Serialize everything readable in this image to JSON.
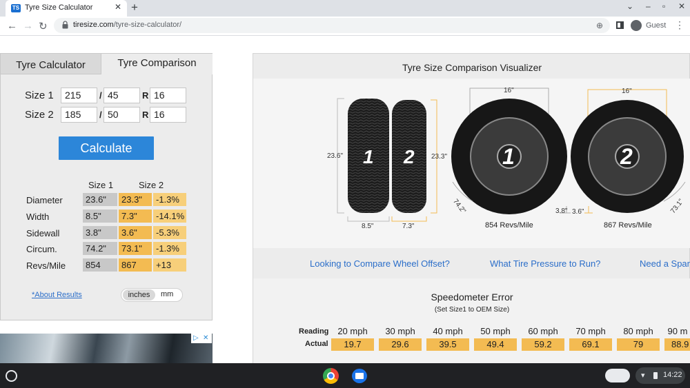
{
  "browser": {
    "tab_title": "Tyre Size Calculator",
    "favicon_text": "TS",
    "url_host": "tiresize.com",
    "url_path": "/tyre-size-calculator/",
    "profile_label": "Guest"
  },
  "calculator": {
    "tabs": [
      {
        "label": "Tyre Calculator"
      },
      {
        "label": "Tyre Comparison"
      }
    ],
    "size1": {
      "label": "Size 1",
      "width": "215",
      "aspect": "45",
      "rim": "16"
    },
    "size2": {
      "label": "Size 2",
      "width": "185",
      "aspect": "50",
      "rim": "16"
    },
    "slash": "/",
    "r": "R",
    "calculate_label": "Calculate",
    "col_headers": {
      "size1": "Size 1",
      "size2": "Size 2"
    },
    "rows": [
      {
        "label": "Diameter",
        "size1": "23.6\"",
        "size2": "23.3\"",
        "diff": "-1.3%"
      },
      {
        "label": "Width",
        "size1": "8.5\"",
        "size2": "7.3\"",
        "diff": "-14.1%"
      },
      {
        "label": "Sidewall",
        "size1": "3.8\"",
        "size2": "3.6\"",
        "diff": "-5.3%"
      },
      {
        "label": "Circum.",
        "size1": "74.2\"",
        "size2": "73.1\"",
        "diff": "-1.3%"
      },
      {
        "label": "Revs/Mile",
        "size1": "854",
        "size2": "867",
        "diff": "+13"
      }
    ],
    "about_link": "*About Results",
    "units": {
      "inches": "inches",
      "mm": "mm"
    }
  },
  "visualizer": {
    "title": "Tyre Size Comparison Visualizer",
    "tyre1_label": "1",
    "tyre2_label": "2",
    "dims": {
      "height1": "23.6\"",
      "height2": "23.3\"",
      "width1": "8.5\"",
      "width2": "7.3\"",
      "rim1": "16\"",
      "rim2": "16\"",
      "sidewall1": "3.8\"",
      "sidewall2": "3.6\"",
      "circ1": "74.2\"",
      "circ2": "73.1\""
    },
    "revs1": "854 Revs/Mile",
    "revs2": "867 Revs/Mile",
    "links": [
      "Looking to Compare Wheel Offset?",
      "What Tire Pressure to Run?",
      "Need a Spar"
    ]
  },
  "speedometer": {
    "title": "Speedometer Error",
    "subtitle": "(Set Size1 to OEM Size)",
    "reading_label": "Reading",
    "actual_label": "Actual",
    "readings": [
      "20 mph",
      "30 mph",
      "40 mph",
      "50 mph",
      "60 mph",
      "70 mph",
      "80 mph",
      "90 m"
    ],
    "actuals": [
      "19.7",
      "29.6",
      "39.5",
      "49.4",
      "59.2",
      "69.1",
      "79",
      "88.9"
    ]
  },
  "taskbar": {
    "clock": "14:22"
  },
  "colors": {
    "accent": "#2c86d9",
    "highlight": "#f3bb52",
    "neutral_cell": "#c8c8c8"
  }
}
